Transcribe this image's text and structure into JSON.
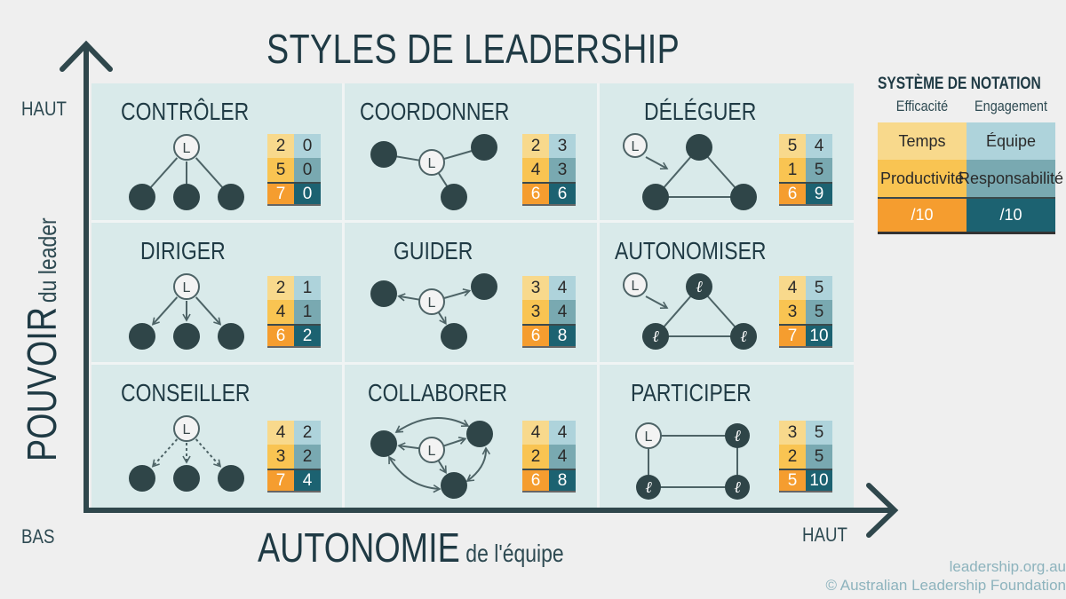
{
  "title": "STYLES DE LEADERSHIP",
  "y_axis": {
    "main": "POUVOIR",
    "sub": "du leader",
    "high_label": "HAUT",
    "low_label": "BAS"
  },
  "x_axis": {
    "main": "AUTONOMIE",
    "sub": "de l'équipe",
    "high_label": "HAUT"
  },
  "legend": {
    "title": "SYSTÈME DE NOTATION",
    "headers": [
      "Efficacité",
      "Engagement"
    ],
    "rows": [
      [
        "Temps",
        "Équipe"
      ],
      [
        "Productivité",
        "Responsabilité"
      ],
      [
        "/10",
        "/10"
      ]
    ]
  },
  "styles": [
    {
      "name": "CONTRÔLER",
      "diagram": "tree-lines",
      "scores": [
        [
          2,
          0
        ],
        [
          5,
          0
        ],
        [
          7,
          0
        ]
      ]
    },
    {
      "name": "COORDONNER",
      "diagram": "star-lines",
      "scores": [
        [
          2,
          3
        ],
        [
          4,
          3
        ],
        [
          6,
          6
        ]
      ]
    },
    {
      "name": "DÉLÉGUER",
      "diagram": "triangle-delegate",
      "scores": [
        [
          5,
          4
        ],
        [
          1,
          5
        ],
        [
          6,
          9
        ]
      ]
    },
    {
      "name": "DIRIGER",
      "diagram": "tree-arrows",
      "scores": [
        [
          2,
          1
        ],
        [
          4,
          1
        ],
        [
          6,
          2
        ]
      ]
    },
    {
      "name": "GUIDER",
      "diagram": "star-arrows",
      "scores": [
        [
          3,
          4
        ],
        [
          3,
          4
        ],
        [
          6,
          8
        ]
      ]
    },
    {
      "name": "AUTONOMISER",
      "diagram": "triangle-empower",
      "scores": [
        [
          4,
          5
        ],
        [
          3,
          5
        ],
        [
          7,
          10
        ]
      ]
    },
    {
      "name": "CONSEILLER",
      "diagram": "tree-dashed",
      "scores": [
        [
          4,
          2
        ],
        [
          3,
          2
        ],
        [
          7,
          4
        ]
      ]
    },
    {
      "name": "COLLABORER",
      "diagram": "network-arrows",
      "scores": [
        [
          4,
          4
        ],
        [
          2,
          4
        ],
        [
          6,
          8
        ]
      ]
    },
    {
      "name": "PARTICIPER",
      "diagram": "square-participate",
      "scores": [
        [
          3,
          5
        ],
        [
          2,
          5
        ],
        [
          5,
          10
        ]
      ]
    }
  ],
  "leader_glyph": "L",
  "member_leader_glyph": "ℓ",
  "credits": [
    "leadership.org.au",
    "© Australian Leadership Foundation"
  ]
}
